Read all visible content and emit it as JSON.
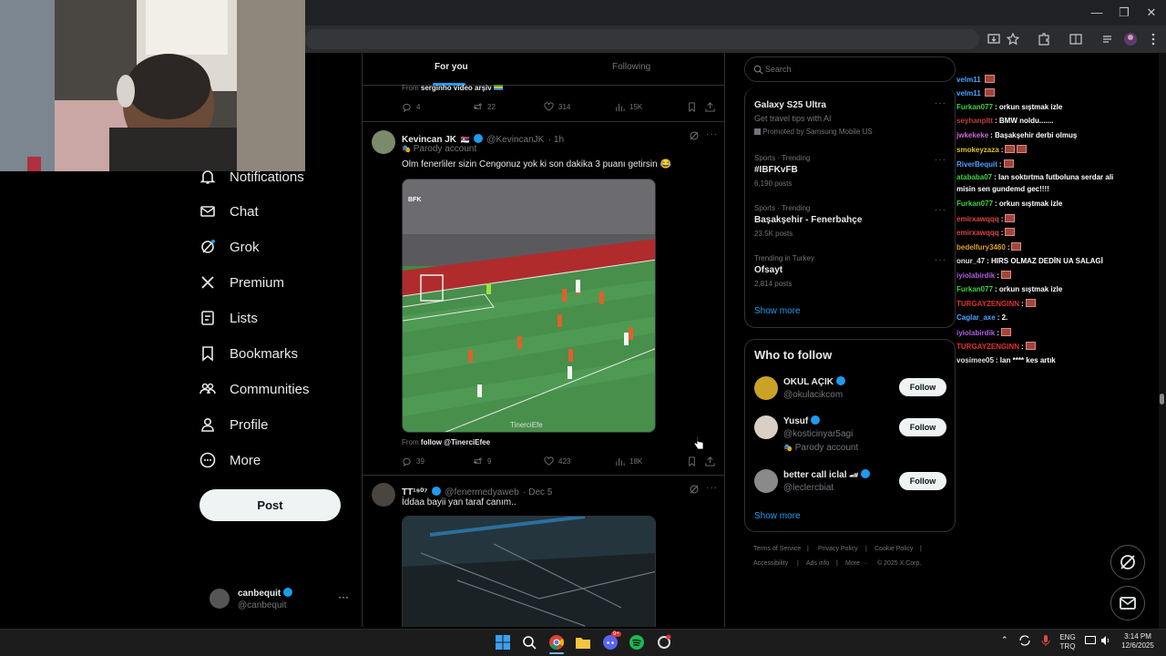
{
  "browser": {
    "window_controls": [
      "—",
      "❐",
      "✕"
    ],
    "toolbar_icons": [
      "install-icon",
      "star-icon",
      "extensions-icon",
      "split-icon",
      "media-icon",
      "profile-icon",
      "menu-icon"
    ]
  },
  "nav": {
    "items": [
      {
        "label": "Notifications",
        "icon": "bell-icon"
      },
      {
        "label": "Chat",
        "icon": "mail-icon"
      },
      {
        "label": "Grok",
        "icon": "grok-icon"
      },
      {
        "label": "Premium",
        "icon": "x-icon"
      },
      {
        "label": "Lists",
        "icon": "list-icon"
      },
      {
        "label": "Bookmarks",
        "icon": "bookmark-icon"
      },
      {
        "label": "Communities",
        "icon": "people-icon"
      },
      {
        "label": "Profile",
        "icon": "person-icon"
      },
      {
        "label": "More",
        "icon": "more-circle-icon"
      }
    ],
    "post_label": "Post",
    "account": {
      "name": "canbequit",
      "handle": "@canbequit"
    }
  },
  "timeline": {
    "tabs": [
      {
        "label": "For you",
        "active": true
      },
      {
        "label": "Following",
        "active": false
      }
    ],
    "prev_tweet": {
      "source_prefix": "From",
      "source": "serginho video arşiv",
      "replies": "4",
      "reposts": "22",
      "likes": "314",
      "views": "15K"
    },
    "tweet1": {
      "name": "Kevincan JK",
      "handle": "@KevincanJK",
      "time": "· 1h",
      "badge": "Parody account",
      "text": "Olm fenerliler sizin Cengonuz yok ki son dakika 3 puanı getirsin 😂",
      "media_tag": "BFK",
      "media_watermark": "TinerciEfe",
      "source_prefix": "From",
      "source": "follow @TinerciEfee",
      "replies": "39",
      "reposts": "9",
      "likes": "423",
      "views": "18K"
    },
    "tweet2": {
      "name": "TT¹⁹⁰⁷",
      "handle": "@fenermedyaweb",
      "time": "· Dec 5",
      "text": "İddaa bayii yan taraf canım.."
    }
  },
  "search": {
    "placeholder": "Search"
  },
  "trends": {
    "promo": {
      "title": "Galaxy S25 Ultra",
      "subtitle": "Get travel tips with AI",
      "promoted": "Promoted by Samsung Mobile US"
    },
    "items": [
      {
        "category": "Sports · Trending",
        "title": "#IBFKvFB",
        "count": "6,190 posts"
      },
      {
        "category": "Sports · Trending",
        "title": "Başakşehir - Fenerbahçe",
        "count": "23.5K posts"
      },
      {
        "category": "Trending in Turkey",
        "title": "Ofsayt",
        "count": "2,814 posts"
      }
    ],
    "show_more": "Show more"
  },
  "who_to_follow": {
    "title": "Who to follow",
    "accounts": [
      {
        "name": "OKUL AÇIK",
        "handle": "@okulacikcom",
        "badge": "",
        "button": "Follow"
      },
      {
        "name": "Yusuf",
        "handle": "@kosticinyar5agi",
        "badge": "Parody account",
        "button": "Follow"
      },
      {
        "name": "better call iclal",
        "handle": "@leclercbiat",
        "badge": "",
        "button": "Follow"
      }
    ],
    "show_more": "Show more"
  },
  "footer": {
    "links": [
      "Terms of Service",
      "Privacy Policy",
      "Cookie Policy",
      "Accessibility",
      "Ads info",
      "More ···",
      "© 2025 X Corp."
    ]
  },
  "chat": [
    {
      "user": "velm11",
      "color": "#4aa3ff",
      "msg": "",
      "emotes": 1
    },
    {
      "user": "velm11",
      "color": "#4aa3ff",
      "msg": "",
      "emotes": 1
    },
    {
      "user": "Furkan077",
      "color": "#3fd23f",
      "msg": ": orkun sıştmak izle",
      "emotes": 0
    },
    {
      "user": "seyhanpltt",
      "color": "#c43b3b",
      "msg": ": BMW noldu.......",
      "emotes": 0
    },
    {
      "user": "jwkekeke",
      "color": "#d06bd0",
      "msg": ": Başakşehir derbi olmuş",
      "emotes": 0
    },
    {
      "user": "smokeyzaza",
      "color": "#e0c030",
      "msg": ":",
      "emotes": 2
    },
    {
      "user": "RiverBequit",
      "color": "#4aa3ff",
      "msg": ":",
      "emotes": 1
    },
    {
      "user": "atababa07",
      "color": "#3fd23f",
      "msg": ": lan soktırtma futboluna serdar ali",
      "emotes": 0
    },
    {
      "user": "",
      "color": "#fff",
      "msg": "misin sen gundemd gec!!!!",
      "emotes": 0
    },
    {
      "user": "Furkan077",
      "color": "#3fd23f",
      "msg": ": orkun sıştmak izle",
      "emotes": 0
    },
    {
      "user": "emirxawqqq",
      "color": "#e04040",
      "msg": ":",
      "emotes": 1
    },
    {
      "user": "emirxawqqq",
      "color": "#e04040",
      "msg": ":",
      "emotes": 1
    },
    {
      "user": "bedelfury3460",
      "color": "#e0a020",
      "msg": ":",
      "emotes": 1
    },
    {
      "user": "onur_47",
      "color": "#e0e0e0",
      "msg": ": HIRS OLMAZ DEDİN UA SALAGİ",
      "emotes": 0
    },
    {
      "user": "iyiolabirdik",
      "color": "#b05ce0",
      "msg": ":",
      "emotes": 1
    },
    {
      "user": "Furkan077",
      "color": "#3fd23f",
      "msg": ": orkun sıştmak izle",
      "emotes": 0
    },
    {
      "user": "TURGAYZENGINN",
      "color": "#e03030",
      "msg": ":",
      "emotes": 1
    },
    {
      "user": "Caglar_axe",
      "color": "#4aa3ff",
      "msg": ": 2.",
      "emotes": 0
    },
    {
      "user": "iyiolabirdik",
      "color": "#b05ce0",
      "msg": ":",
      "emotes": 1
    },
    {
      "user": "TURGAYZENGINN",
      "color": "#e03030",
      "msg": ":",
      "emotes": 1
    },
    {
      "user": "vosimee05",
      "color": "#e0e0e0",
      "msg": ": lan **** kes artık",
      "emotes": 0
    }
  ],
  "taskbar": {
    "tray_lang": "ENG",
    "tray_lang2": "TRQ",
    "time": "3:14 PM",
    "date": "12/6/2025",
    "discord_badge": "9+"
  }
}
